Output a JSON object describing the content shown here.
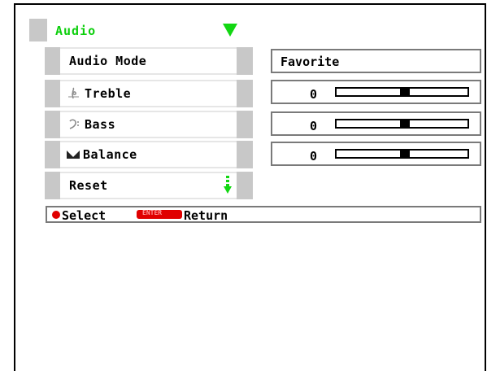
{
  "menu": {
    "title": "Audio",
    "items": [
      {
        "label": "Audio Mode",
        "icon": "none",
        "value": "Favorite"
      },
      {
        "label": "Treble",
        "icon": "treble-icon",
        "value": "0",
        "slider_level": 0.52
      },
      {
        "label": "Bass",
        "icon": "bass-icon",
        "value": "0",
        "slider_level": 0.52
      },
      {
        "label": "Balance",
        "icon": "balance-icon",
        "value": "0",
        "slider_level": 0.52
      },
      {
        "label": "Reset",
        "icon": "down-arrow-icon",
        "value": ""
      }
    ]
  },
  "status": {
    "select_label": "Select",
    "enter_key_label": "ENTER",
    "return_label": "Return"
  },
  "colors": {
    "title_green": "#0ccf0c",
    "arrow_green": "#12d712",
    "key_red": "#e00000"
  }
}
